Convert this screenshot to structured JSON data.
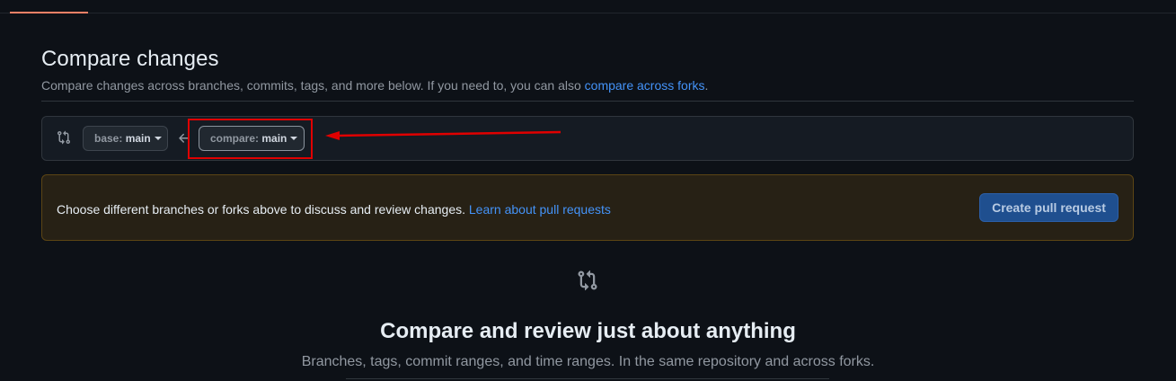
{
  "header": {
    "title": "Compare changes",
    "subtitle_prefix": "Compare changes across branches, commits, tags, and more below. If you need to, you can also ",
    "subtitle_link": "compare across forks",
    "subtitle_suffix": "."
  },
  "range": {
    "base_label": "base:",
    "base_value": "main",
    "compare_label": "compare:",
    "compare_value": "main"
  },
  "flash": {
    "message": "Choose different branches or forks above to discuss and review changes. ",
    "link": "Learn about pull requests",
    "button_label": "Create pull request"
  },
  "blankslate": {
    "title": "Compare and review just about anything",
    "subtitle": "Branches, tags, commit ranges, and time ranges. In the same repository and across forks."
  },
  "colors": {
    "accent_link": "#4493f8",
    "annotation": "#e00000",
    "tab_underline": "#f78166"
  }
}
